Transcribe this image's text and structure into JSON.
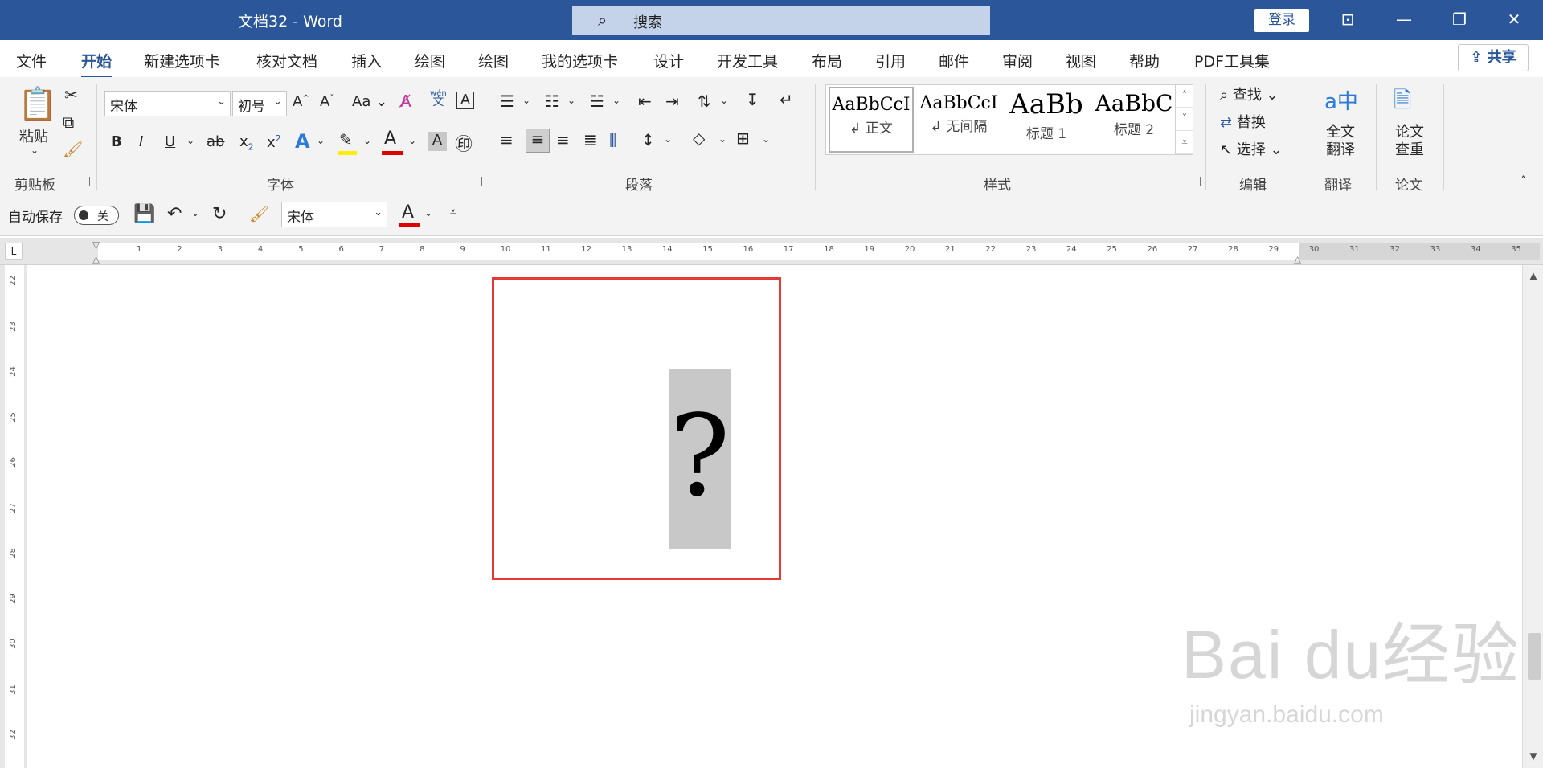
{
  "title": {
    "doc_name": "文档32",
    "app_name": "Word",
    "search_placeholder": "搜索",
    "login_label": "登录"
  },
  "tabs": [
    {
      "label": "文件"
    },
    {
      "label": "开始"
    },
    {
      "label": "新建选项卡"
    },
    {
      "label": "核对文档"
    },
    {
      "label": "插入"
    },
    {
      "label": "绘图"
    },
    {
      "label": "绘图"
    },
    {
      "label": "我的选项卡"
    },
    {
      "label": "设计"
    },
    {
      "label": "开发工具"
    },
    {
      "label": "布局"
    },
    {
      "label": "引用"
    },
    {
      "label": "邮件"
    },
    {
      "label": "审阅"
    },
    {
      "label": "视图"
    },
    {
      "label": "帮助"
    },
    {
      "label": "PDF工具集"
    }
  ],
  "share_label": "共享",
  "clipboard": {
    "paste_label": "粘贴",
    "group_label": "剪贴板"
  },
  "font": {
    "name": "宋体",
    "size": "初号",
    "group_label": "字体",
    "pinyin_top": "wén",
    "pinyin_bottom": "文",
    "change_case": "Aa"
  },
  "paragraph": {
    "group_label": "段落"
  },
  "styles": {
    "group_label": "样式",
    "items": [
      {
        "sample": "AaBbCcI",
        "name": "正文"
      },
      {
        "sample": "AaBbCcI",
        "name": "无间隔"
      },
      {
        "sample": "AaBb",
        "name": "标题 1"
      },
      {
        "sample": "AaBbC",
        "name": "标题 2"
      }
    ]
  },
  "editing": {
    "find": "查找",
    "replace": "替换",
    "select": "选择",
    "group_label": "编辑"
  },
  "translate": {
    "line1": "全文",
    "line2": "翻译",
    "group_label": "翻译"
  },
  "paper": {
    "line1": "论文",
    "line2": "查重",
    "group_label": "论文"
  },
  "qat": {
    "autosave_label": "自动保存",
    "toggle_state": "关",
    "font_name": "宋体"
  },
  "ruler": {
    "h_numbers": [
      "1",
      "2",
      "3",
      "4",
      "5",
      "6",
      "7",
      "8",
      "9",
      "10",
      "11",
      "12",
      "13",
      "14",
      "15",
      "16",
      "17",
      "18",
      "19",
      "20",
      "21",
      "22",
      "23",
      "24",
      "25",
      "26",
      "27",
      "28",
      "29",
      "30",
      "31",
      "32",
      "33",
      "34",
      "35"
    ],
    "v_numbers": [
      "22",
      "23",
      "24",
      "25",
      "26",
      "27",
      "28",
      "29",
      "30",
      "31",
      "32"
    ]
  },
  "content": {
    "placeholder_glyph": "?"
  },
  "watermark": {
    "brand": "Bai du经验",
    "url": "jingyan.baidu.com"
  },
  "colors": {
    "brand_blue": "#2b579a",
    "highlight_red": "#e53935",
    "font_color_red": "#e00000",
    "highlight_yellow": "#ffee00"
  }
}
